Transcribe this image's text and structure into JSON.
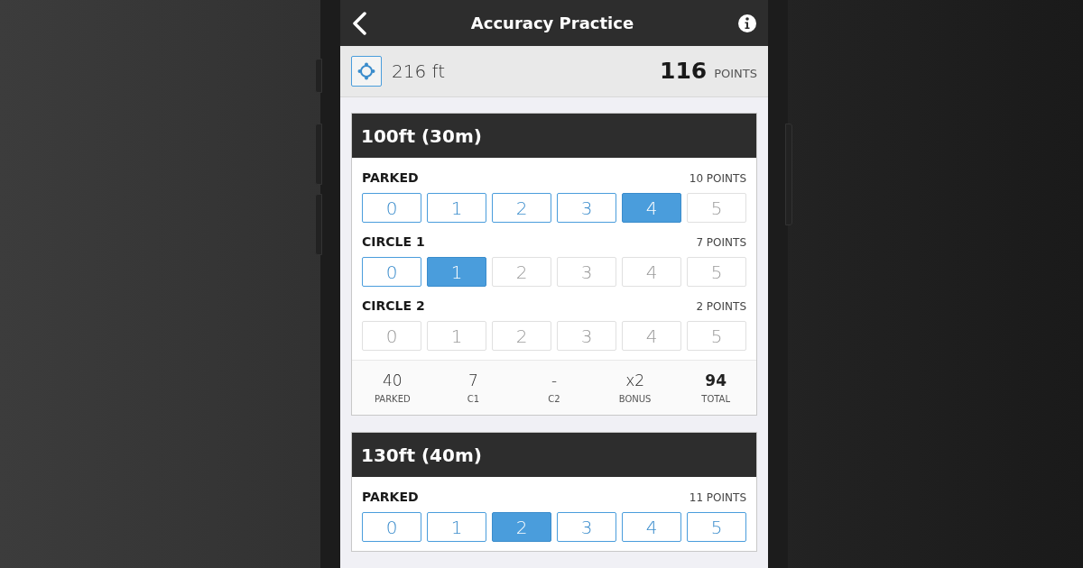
{
  "header": {
    "title": "Accuracy Practice"
  },
  "status": {
    "distance": "216 ft",
    "points": "116",
    "points_unit": "POINTS"
  },
  "rounds": [
    {
      "title": "100ft (30m)",
      "rows": [
        {
          "label": "PARKED",
          "points": "10 POINTS",
          "options": [
            {
              "label": "0",
              "selected": false,
              "disabled": false
            },
            {
              "label": "1",
              "selected": false,
              "disabled": false
            },
            {
              "label": "2",
              "selected": false,
              "disabled": false
            },
            {
              "label": "3",
              "selected": false,
              "disabled": false
            },
            {
              "label": "4",
              "selected": true,
              "disabled": false
            },
            {
              "label": "5",
              "selected": false,
              "disabled": true
            }
          ]
        },
        {
          "label": "CIRCLE 1",
          "points": "7 POINTS",
          "options": [
            {
              "label": "0",
              "selected": false,
              "disabled": false
            },
            {
              "label": "1",
              "selected": true,
              "disabled": false
            },
            {
              "label": "2",
              "selected": false,
              "disabled": true
            },
            {
              "label": "3",
              "selected": false,
              "disabled": true
            },
            {
              "label": "4",
              "selected": false,
              "disabled": true
            },
            {
              "label": "5",
              "selected": false,
              "disabled": true
            }
          ]
        },
        {
          "label": "CIRCLE 2",
          "points": "2 POINTS",
          "options": [
            {
              "label": "0",
              "selected": false,
              "disabled": true
            },
            {
              "label": "1",
              "selected": false,
              "disabled": true
            },
            {
              "label": "2",
              "selected": false,
              "disabled": true
            },
            {
              "label": "3",
              "selected": false,
              "disabled": true
            },
            {
              "label": "4",
              "selected": false,
              "disabled": true
            },
            {
              "label": "5",
              "selected": false,
              "disabled": true
            }
          ]
        }
      ],
      "summary": [
        {
          "value": "40",
          "label": "PARKED",
          "bold": false
        },
        {
          "value": "7",
          "label": "C1",
          "bold": false
        },
        {
          "value": "-",
          "label": "C2",
          "bold": false
        },
        {
          "value": "x2",
          "label": "BONUS",
          "bold": false
        },
        {
          "value": "94",
          "label": "TOTAL",
          "bold": true
        }
      ]
    },
    {
      "title": "130ft (40m)",
      "rows": [
        {
          "label": "PARKED",
          "points": "11 POINTS",
          "options": [
            {
              "label": "0",
              "selected": false,
              "disabled": false
            },
            {
              "label": "1",
              "selected": false,
              "disabled": false
            },
            {
              "label": "2",
              "selected": true,
              "disabled": false
            },
            {
              "label": "3",
              "selected": false,
              "disabled": false
            },
            {
              "label": "4",
              "selected": false,
              "disabled": false
            },
            {
              "label": "5",
              "selected": false,
              "disabled": false
            }
          ]
        }
      ]
    }
  ]
}
